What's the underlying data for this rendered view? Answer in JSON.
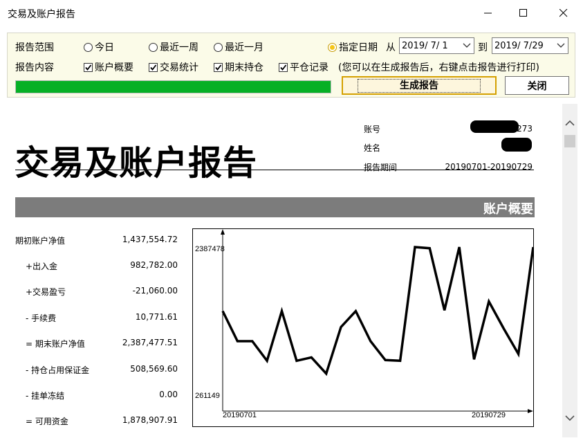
{
  "window": {
    "title": "交易及账户报告"
  },
  "controls": {
    "range_label": "报告范围",
    "content_label": "报告内容",
    "range_options": [
      {
        "label": "今日",
        "selected": false
      },
      {
        "label": "最近一周",
        "selected": false
      },
      {
        "label": "最近一月",
        "selected": false
      },
      {
        "label": "指定日期",
        "selected": true
      }
    ],
    "from_label": "从",
    "to_label": "到",
    "from_date": "2019/ 7/ 1",
    "to_date": "2019/ 7/29",
    "content_options": [
      {
        "label": "账户概要",
        "checked": true
      },
      {
        "label": "交易统计",
        "checked": true
      },
      {
        "label": "期末持仓",
        "checked": true
      },
      {
        "label": "平仓记录",
        "checked": true
      }
    ],
    "hint": "(您可以在生成报告后，右键点击报告进行打印)",
    "progress": 1.0,
    "generate_label": "生成报告",
    "close_label": "关闭"
  },
  "report": {
    "title": "交易及账户报告",
    "account_label": "账号",
    "account_value_visible": "273",
    "name_label": "姓名",
    "period_label": "报告期间",
    "period_value": "20190701-20190729",
    "section_title": "账户概要",
    "summary": [
      {
        "label": "期初账户净值",
        "value": "1,437,554.72"
      },
      {
        "label": "+出入金",
        "value": "982,782.00"
      },
      {
        "label": "+交易盈亏",
        "value": "-21,060.00"
      },
      {
        "label": "- 手续费",
        "value": "10,771.61"
      },
      {
        "label": "= 期末账户净值",
        "value": "2,387,477.51"
      },
      {
        "label": "- 持仓占用保证金",
        "value": "508,569.60"
      },
      {
        "label": "- 挂单冻结",
        "value": "0.00"
      },
      {
        "label": "= 可用资金",
        "value": "1,878,907.91"
      }
    ]
  },
  "chart_data": {
    "type": "line",
    "y_max_label": "2387478",
    "y_min_label": "261149",
    "x_start_label": "20190701",
    "x_end_label": "20190729",
    "ylim": [
      261149,
      2387478
    ],
    "values": [
      1437555,
      990000,
      990000,
      700000,
      1437555,
      700000,
      750000,
      510000,
      1200000,
      1437555,
      990000,
      710000,
      700000,
      2387478,
      2370000,
      1450000,
      2387478,
      720000,
      1580000,
      1180000,
      800000,
      2387478
    ],
    "line_color": "#000000"
  }
}
